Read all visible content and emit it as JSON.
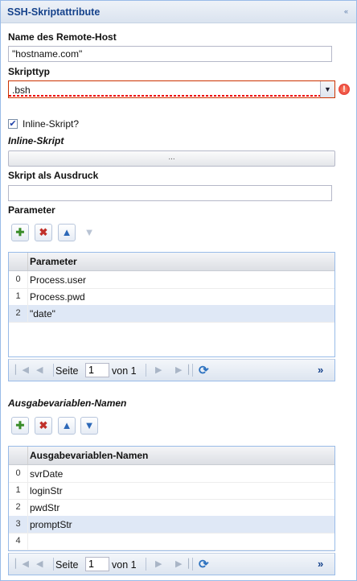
{
  "panel": {
    "title": "SSH-Skriptattribute",
    "collapse_glyph": "«"
  },
  "remote_host": {
    "label": "Name des Remote-Host",
    "value": "\"hostname.com\""
  },
  "script_type": {
    "label": "Skripttyp",
    "value": ".bsh",
    "trigger_glyph": "▼",
    "error_glyph": "!"
  },
  "inline_checkbox": {
    "label": "Inline-Skript?",
    "checked": true,
    "glyph": "✔"
  },
  "inline_script": {
    "label": "Inline-Skript",
    "button": "..."
  },
  "script_expression": {
    "label": "Skript als Ausdruck",
    "value": ""
  },
  "parameters": {
    "label": "Parameter",
    "column_header": "Parameter",
    "rows": [
      {
        "num": "0",
        "value": "Process.user"
      },
      {
        "num": "1",
        "value": "Process.pwd"
      },
      {
        "num": "2",
        "value": "\"date\""
      }
    ],
    "selected_row": 2,
    "pager": {
      "page_label": "Seite",
      "page": "1",
      "of_label": "von 1"
    }
  },
  "output_vars": {
    "label": "Ausgabevariablen-Namen",
    "column_header": "Ausgabevariablen-Namen",
    "rows": [
      {
        "num": "0",
        "value": "svrDate"
      },
      {
        "num": "1",
        "value": "loginStr"
      },
      {
        "num": "2",
        "value": "pwdStr"
      },
      {
        "num": "3",
        "value": "promptStr"
      },
      {
        "num": "4",
        "value": ""
      }
    ],
    "selected_row": 3,
    "pager": {
      "page_label": "Seite",
      "page": "1",
      "of_label": "von 1"
    }
  },
  "icons": {
    "add": "add-row-icon",
    "delete": "delete-row-icon",
    "up": "arrow-up-icon",
    "down": "arrow-down-icon",
    "first": "first-page-icon",
    "prev": "prev-page-icon",
    "next": "next-page-icon",
    "last": "last-page-icon",
    "refresh": "refresh-icon",
    "more": "more-icon"
  },
  "colors": {
    "accent": "#15428b",
    "border": "#99bbe8",
    "selected_row": "#dfe8f6",
    "error": "#dd2222"
  }
}
